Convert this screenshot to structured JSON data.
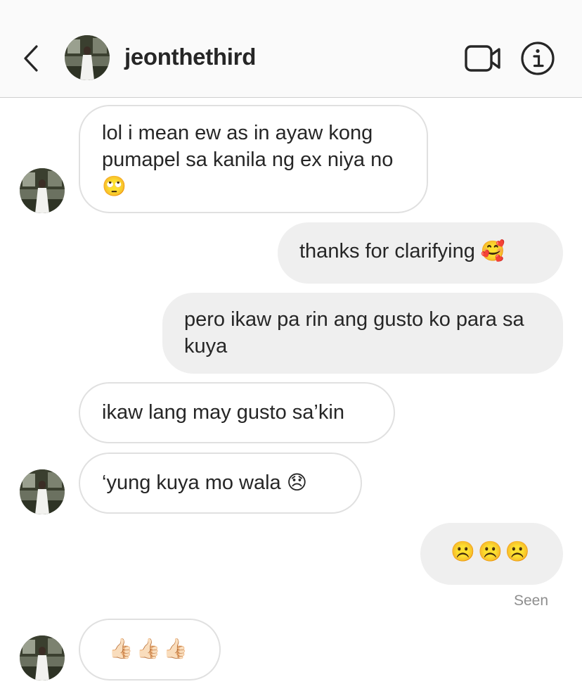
{
  "header": {
    "username": "jeonthethird"
  },
  "icons": {
    "back": "chevron-left-icon",
    "video": "video-camera-icon",
    "info": "info-icon"
  },
  "messages": [
    {
      "direction": "in",
      "text": "lol i mean ew as in ayaw kong pumapel sa kanila ng ex niya no",
      "emoji": "🙄"
    },
    {
      "direction": "out",
      "text": "thanks for clarifying",
      "emoji": "🥰"
    },
    {
      "direction": "out",
      "text": "pero ikaw pa rin ang gusto ko para sa kuya",
      "emoji": ""
    },
    {
      "direction": "in",
      "text": "ikaw lang may gusto sa’kin",
      "emoji": ""
    },
    {
      "direction": "in",
      "text": "‘yung kuya mo wala",
      "emoji": "😞"
    },
    {
      "direction": "out",
      "text": "",
      "emoji": "☹️☹️☹️"
    },
    {
      "direction": "in",
      "text": "",
      "emoji": "👍🏻👍🏻👍🏻"
    }
  ],
  "seen_label": "Seen"
}
